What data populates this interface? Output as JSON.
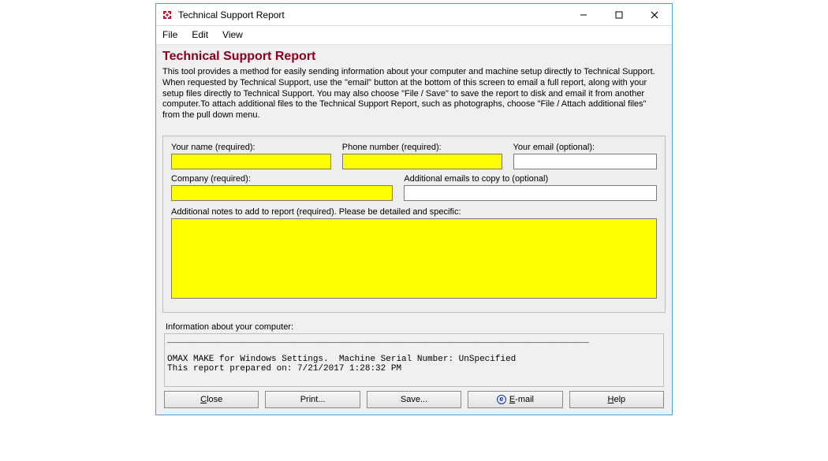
{
  "window": {
    "title": "Technical Support Report"
  },
  "menubar": {
    "file": "File",
    "edit": "Edit",
    "view": "View"
  },
  "header": {
    "title": "Technical Support Report",
    "intro": "This tool provides a method for easily sending information about your computer and machine setup directly to Technical Support.  When requested by Technical Support, use the \"email\" button at the bottom of this screen to email a full report, along with your setup files directly to Technical Support.  You may also choose \"File / Save\" to save the report to disk and email it from another computer.To attach additional files to the Technical Support Report, such as photographs, choose \"File / Attach additional files\" from the pull down menu."
  },
  "form": {
    "name_label": "Your name (required):",
    "name_value": "",
    "phone_label": "Phone number (required):",
    "phone_value": "",
    "email_label": "Your email (optional):",
    "email_value": "",
    "company_label": "Company (required):",
    "company_value": "",
    "cc_label": "Additional emails to copy to (optional)",
    "cc_value": "",
    "notes_label": "Additional notes to add to report (required).  Please be detailed and specific:",
    "notes_value": ""
  },
  "info": {
    "label": "Information about your computer:",
    "text": "_________________________________________________________________________________\n\nOMAX MAKE for Windows Settings.  Machine Serial Number: UnSpecified\nThis report prepared on: 7/21/2017 1:28:32 PM"
  },
  "buttons": {
    "close": "Close",
    "print": "Print...",
    "save": "Save...",
    "email": "E-mail",
    "help": "Help"
  }
}
